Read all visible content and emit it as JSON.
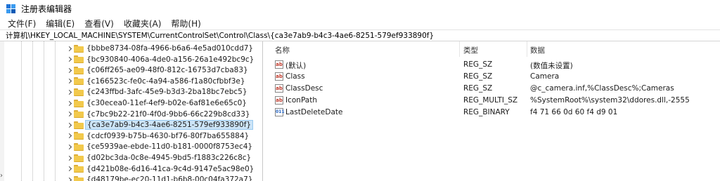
{
  "window": {
    "title": "注册表编辑器",
    "accent": "#1e73d6"
  },
  "menu": [
    {
      "label": "文件(F)"
    },
    {
      "label": "编辑(E)"
    },
    {
      "label": "查看(V)"
    },
    {
      "label": "收藏夹(A)"
    },
    {
      "label": "帮助(H)"
    }
  ],
  "address": {
    "path": "计算机\\HKEY_LOCAL_MACHINE\\SYSTEM\\CurrentControlSet\\Control\\Class\\{ca3e7ab9-b4c3-4ae6-8251-579ef933890f}"
  },
  "tree": {
    "items": [
      {
        "label": "{bbbe8734-08fa-4966-b6a6-4e5ad010cdd7}",
        "selected": false
      },
      {
        "label": "{bc930840-406a-4de0-a156-26a1e492bc9c}",
        "selected": false
      },
      {
        "label": "{c06ff265-ae09-48f0-812c-16753d7cba83}",
        "selected": false
      },
      {
        "label": "{c166523c-fe0c-4a94-a586-f1a80cfbbf3e}",
        "selected": false
      },
      {
        "label": "{c243ffbd-3afc-45e9-b3d3-2ba18bc7ebc5}",
        "selected": false
      },
      {
        "label": "{c30ecea0-11ef-4ef9-b02e-6af81e6e65c0}",
        "selected": false
      },
      {
        "label": "{c7bc9b22-21f0-4f0d-9bb6-66c229b8cd33}",
        "selected": false
      },
      {
        "label": "{ca3e7ab9-b4c3-4ae6-8251-579ef933890f}",
        "selected": true
      },
      {
        "label": "{cdcf0939-b75b-4630-bf76-80f7ba655884}",
        "selected": false
      },
      {
        "label": "{ce5939ae-ebde-11d0-b181-0000f8753ec4}",
        "selected": false
      },
      {
        "label": "{d02bc3da-0c8e-4945-9bd5-f1883c226c8c}",
        "selected": false
      },
      {
        "label": "{d421b08e-6d16-41ca-9c4d-9147e5ac98e0}",
        "selected": false
      },
      {
        "label": "{d48179be-ec20-11d1-b6b8-00c04fa372a7}",
        "selected": false
      }
    ]
  },
  "list": {
    "headers": {
      "name": "名称",
      "type": "类型",
      "data": "数据"
    },
    "rows": [
      {
        "name": "(默认)",
        "type": "REG_SZ",
        "data": "(数值未设置)",
        "icon": "string-value-icon"
      },
      {
        "name": "Class",
        "type": "REG_SZ",
        "data": "Camera",
        "icon": "string-value-icon"
      },
      {
        "name": "ClassDesc",
        "type": "REG_SZ",
        "data": "@c_camera.inf,%ClassDesc%;Cameras",
        "icon": "string-value-icon"
      },
      {
        "name": "IconPath",
        "type": "REG_MULTI_SZ",
        "data": "%SystemRoot%\\system32\\ddores.dll,-2555",
        "icon": "string-value-icon"
      },
      {
        "name": "LastDeleteDate",
        "type": "REG_BINARY",
        "data": "f4 71 66 0d 60 f4 d9 01",
        "icon": "binary-value-icon"
      }
    ]
  }
}
